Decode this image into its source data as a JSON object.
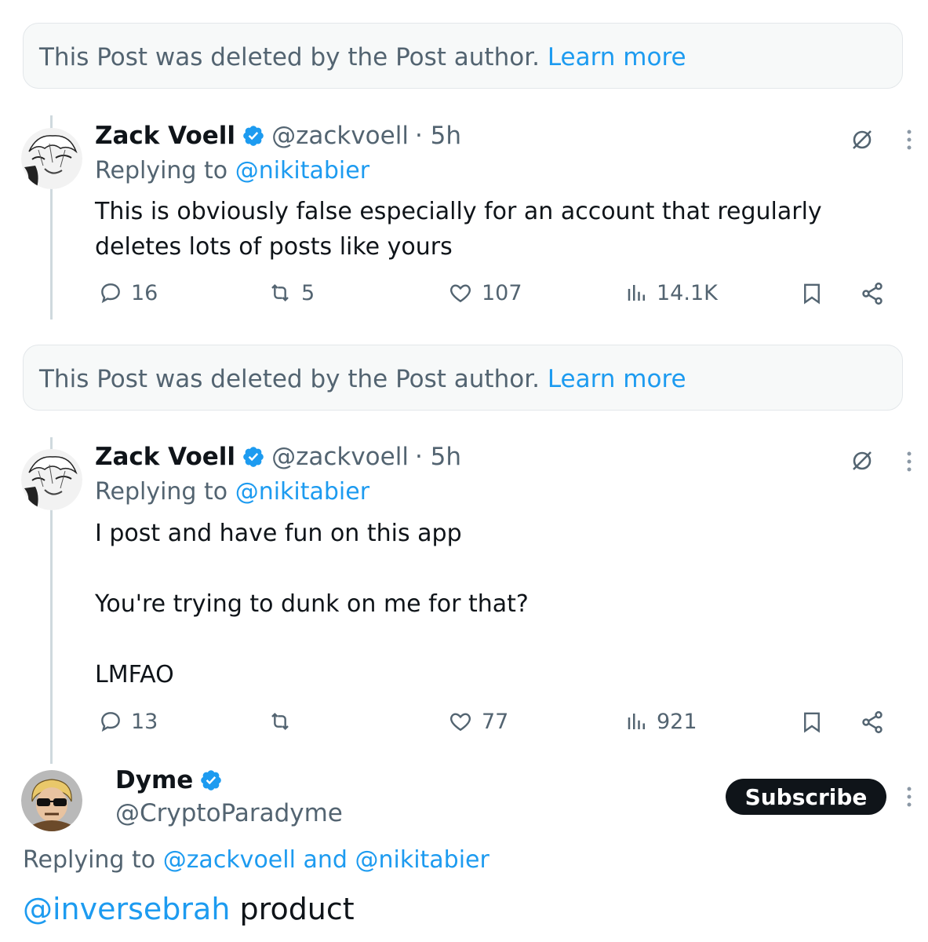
{
  "deleted_notice": {
    "text": "This Post was deleted by the Post author.",
    "link": "Learn more"
  },
  "posts": [
    {
      "name": "Zack Voell",
      "handle": "@zackvoell",
      "time": "· 5h",
      "replying_prefix": "Replying to",
      "replying_to": "@nikitabier",
      "lines": [
        "This is obviously false especially for an account that regularly",
        "deletes lots of posts like yours"
      ],
      "stats": {
        "replies": "16",
        "reposts": "5",
        "likes": "107",
        "views": "14.1K"
      }
    },
    {
      "name": "Zack Voell",
      "handle": "@zackvoell",
      "time": "· 5h",
      "replying_prefix": "Replying to",
      "replying_to": "@nikitabier",
      "lines": [
        "I post and have fun on this app",
        "You're trying to dunk on me for that?",
        "LMFAO"
      ],
      "stats": {
        "replies": "13",
        "reposts": "",
        "likes": "77",
        "views": "921"
      }
    }
  ],
  "focus_post": {
    "name": "Dyme",
    "handle": "@CryptoParadyme",
    "subscribe_label": "Subscribe",
    "replying_prefix": "Replying to",
    "replying_user1": "@zackvoell",
    "replying_and": "and",
    "replying_user2": "@nikitabier",
    "mention": "@inversebrah",
    "text": "product"
  },
  "colors": {
    "accent": "#1d9bf0",
    "muted": "#536471",
    "text": "#0f1419",
    "verified": "#1d9bf0"
  },
  "icons": [
    "verified-badge-icon",
    "grok-icon",
    "more-icon",
    "reply-icon",
    "repost-icon",
    "like-icon",
    "views-icon",
    "bookmark-icon",
    "share-icon"
  ]
}
